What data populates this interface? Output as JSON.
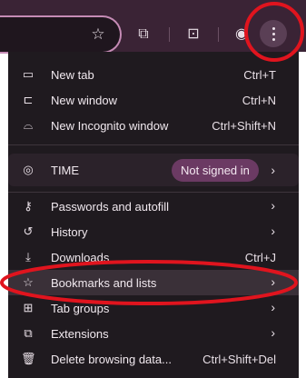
{
  "toolbar": {
    "icons": [
      "star-icon",
      "extensions-puzzle-icon",
      "tab-search-icon",
      "profile-icon",
      "more-vert-icon"
    ]
  },
  "menu": {
    "items": [
      {
        "label": "New tab",
        "shortcut": "Ctrl+T",
        "icon": "new-tab-icon"
      },
      {
        "label": "New window",
        "shortcut": "Ctrl+N",
        "icon": "new-window-icon"
      },
      {
        "label": "New Incognito window",
        "shortcut": "Ctrl+Shift+N",
        "icon": "incognito-icon"
      }
    ],
    "profile": {
      "label": "TIME",
      "badge": "Not signed in",
      "icon": "account-circle-icon"
    },
    "lower": [
      {
        "label": "Passwords and autofill",
        "icon": "key-icon",
        "submenu": true
      },
      {
        "label": "History",
        "icon": "history-icon",
        "submenu": true
      },
      {
        "label": "Downloads",
        "shortcut": "Ctrl+J",
        "icon": "download-icon"
      },
      {
        "label": "Bookmarks and lists",
        "icon": "star-outline-icon",
        "submenu": true
      },
      {
        "label": "Tab groups",
        "icon": "tab-groups-icon",
        "submenu": true
      },
      {
        "label": "Extensions",
        "icon": "extensions-icon",
        "submenu": true
      },
      {
        "label": "Delete browsing data...",
        "shortcut": "Ctrl+Shift+Del",
        "icon": "trash-icon"
      }
    ]
  },
  "colors": {
    "menu_bg": "#1f1a1f",
    "toolbar_bg": "#3a2335",
    "annotation": "#e0141e",
    "badge_bg": "#6b3a63"
  }
}
